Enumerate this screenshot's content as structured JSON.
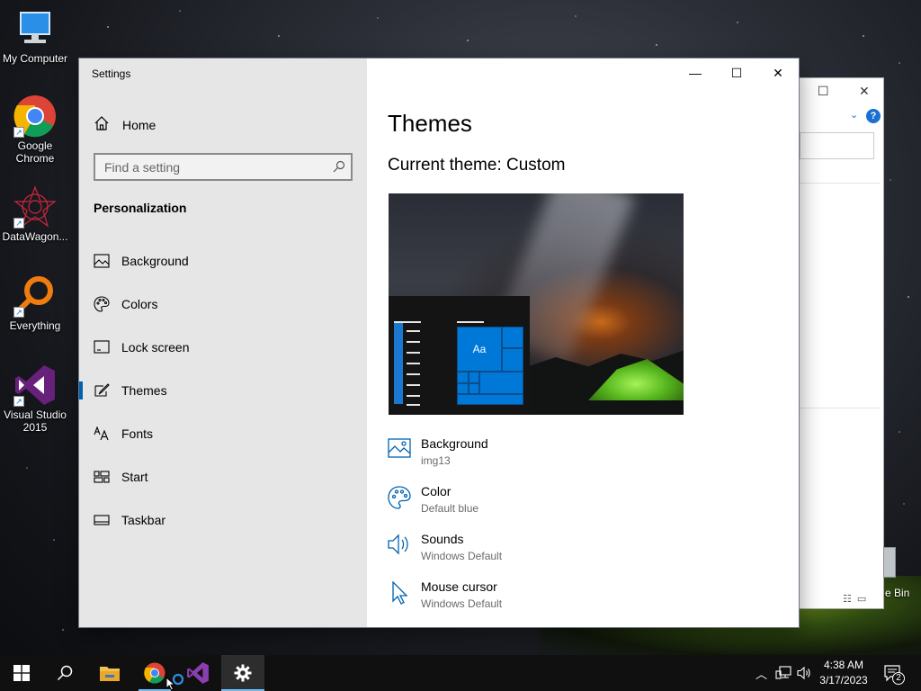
{
  "desktop": {
    "icons": [
      {
        "label": "My Computer"
      },
      {
        "label": "Google Chrome"
      },
      {
        "label": "DataWagon..."
      },
      {
        "label": "Everything"
      },
      {
        "label": "Visual Studio 2015"
      }
    ],
    "recycle_bin_label": "e Bin"
  },
  "window": {
    "title": "Settings",
    "controls": {
      "minimize": "—",
      "maximize": "☐",
      "close": "✕"
    }
  },
  "sidebar": {
    "home_label": "Home",
    "search": {
      "placeholder": "Find a setting",
      "value": ""
    },
    "section_title": "Personalization",
    "items": [
      {
        "label": "Background",
        "icon": "image-icon"
      },
      {
        "label": "Colors",
        "icon": "palette-icon"
      },
      {
        "label": "Lock screen",
        "icon": "lock-screen-icon"
      },
      {
        "label": "Themes",
        "icon": "brush-icon",
        "active": true
      },
      {
        "label": "Fonts",
        "icon": "font-icon"
      },
      {
        "label": "Start",
        "icon": "start-grid-icon"
      },
      {
        "label": "Taskbar",
        "icon": "taskbar-icon"
      }
    ]
  },
  "main": {
    "title": "Themes",
    "current_theme": "Current theme: Custom",
    "preview_tile_text": "Aa",
    "properties": [
      {
        "name": "Background",
        "value": "img13",
        "icon": "image-icon"
      },
      {
        "name": "Color",
        "value": "Default blue",
        "icon": "palette-icon"
      },
      {
        "name": "Sounds",
        "value": "Windows Default",
        "icon": "speaker-icon"
      },
      {
        "name": "Mouse cursor",
        "value": "Windows Default",
        "icon": "cursor-icon"
      }
    ]
  },
  "taskbar": {
    "time": "4:38 AM",
    "date": "3/17/2023",
    "notification_count": "2",
    "accent": "#76b9ed"
  },
  "colors": {
    "accent": "#0078d7",
    "sidebar_bg": "#e6e6e6"
  }
}
